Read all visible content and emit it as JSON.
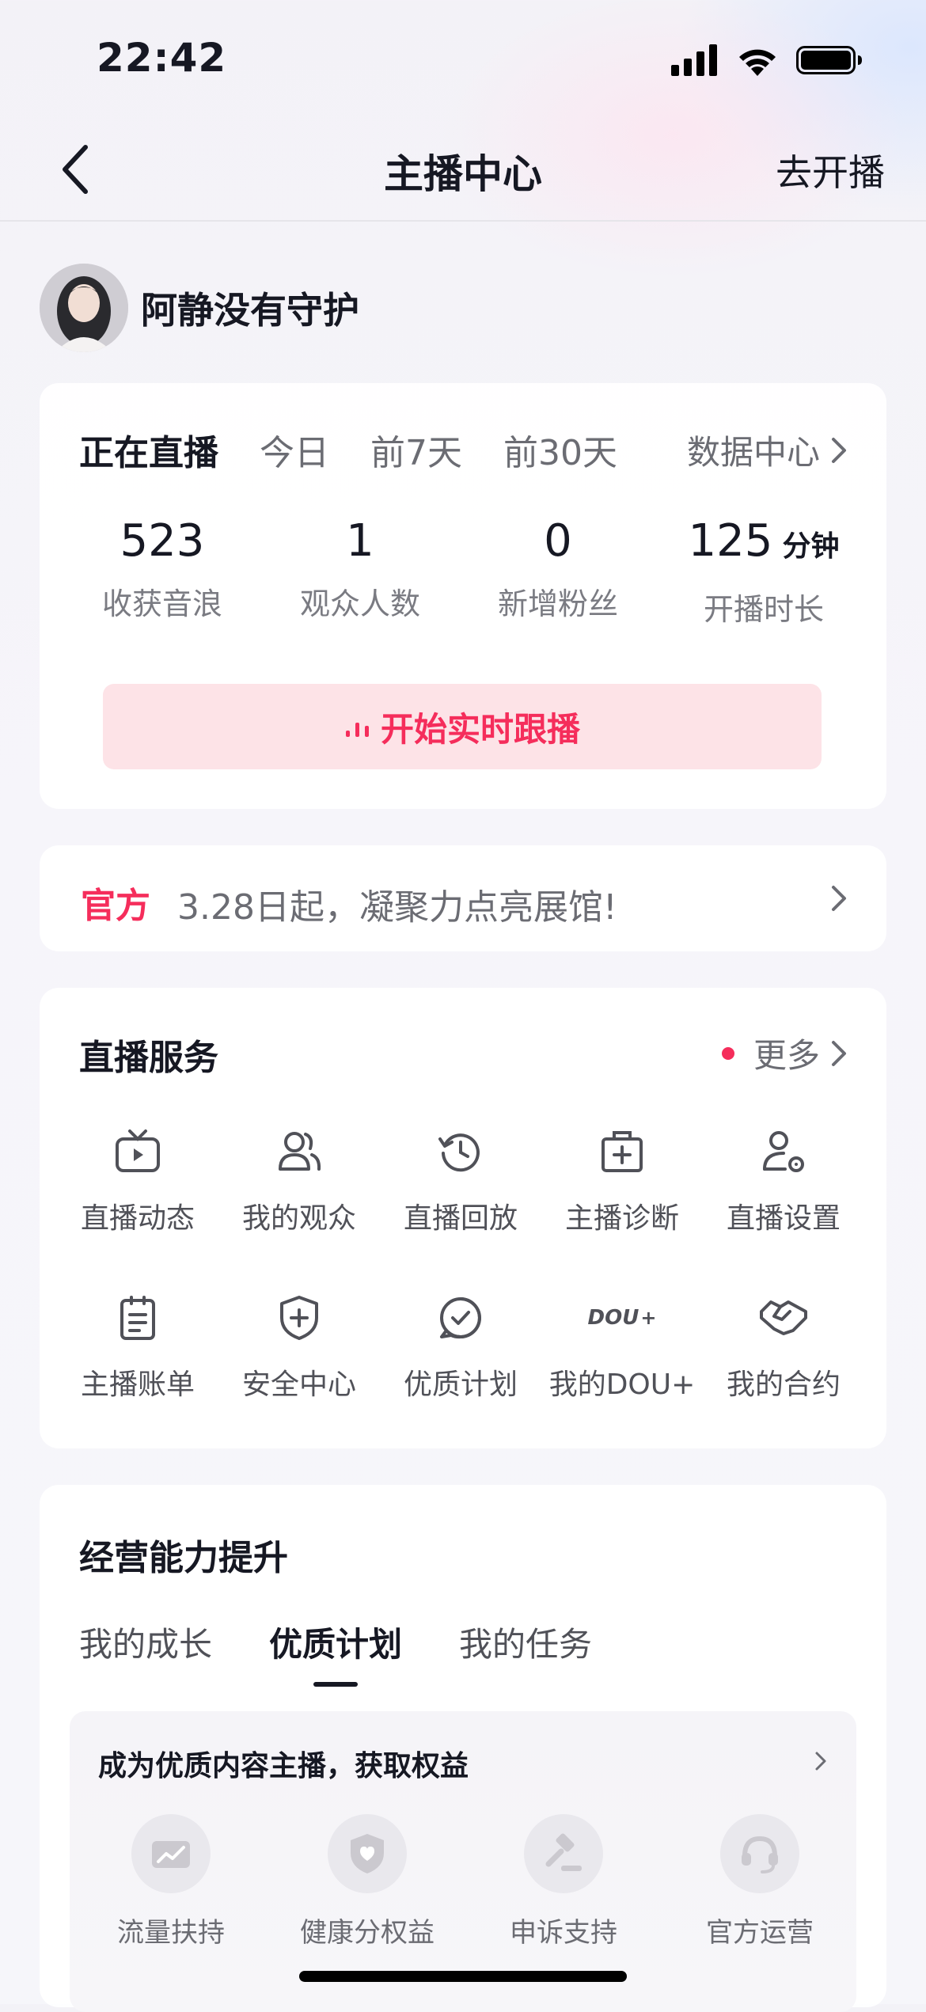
{
  "status_bar": {
    "time": "22:42"
  },
  "nav": {
    "title": "主播中心",
    "right_action": "去开播"
  },
  "user": {
    "name": "阿静没有守护"
  },
  "live_card": {
    "tabs": [
      "正在直播",
      "今日",
      "前7天",
      "前30天"
    ],
    "active_tab": "正在直播",
    "data_center": "数据中心",
    "stats": [
      {
        "value": "523",
        "unit": "",
        "label": "收获音浪"
      },
      {
        "value": "1",
        "unit": "",
        "label": "观众人数"
      },
      {
        "value": "0",
        "unit": "",
        "label": "新增粉丝"
      },
      {
        "value": "125",
        "unit": "分钟",
        "label": "开播时长"
      }
    ],
    "follow_button": "开始实时跟播"
  },
  "notice": {
    "tag": "官方",
    "text": "3.28日起，凝聚力点亮展馆!"
  },
  "services": {
    "title": "直播服务",
    "more": "更多",
    "items": [
      {
        "label": "直播动态",
        "icon": "tv-play-icon"
      },
      {
        "label": "我的观众",
        "icon": "audience-icon"
      },
      {
        "label": "直播回放",
        "icon": "replay-clock-icon"
      },
      {
        "label": "主播诊断",
        "icon": "diagnosis-kit-icon"
      },
      {
        "label": "直播设置",
        "icon": "user-settings-icon"
      },
      {
        "label": "主播账单",
        "icon": "bill-icon"
      },
      {
        "label": "安全中心",
        "icon": "shield-plus-icon"
      },
      {
        "label": "优质计划",
        "icon": "quality-check-icon"
      },
      {
        "label": "我的DOU+",
        "icon": "dou-plus-icon",
        "icon_text": "DOU"
      },
      {
        "label": "我的合约",
        "icon": "handshake-icon"
      }
    ]
  },
  "business": {
    "title": "经营能力提升",
    "tabs": [
      "我的成长",
      "优质计划",
      "我的任务"
    ],
    "active_tab": "优质计划",
    "banner_title": "成为优质内容主播，获取权益",
    "benefits": [
      {
        "label": "流量扶持",
        "icon": "traffic-icon"
      },
      {
        "label": "健康分权益",
        "icon": "health-shield-icon"
      },
      {
        "label": "申诉支持",
        "icon": "gavel-icon"
      },
      {
        "label": "官方运营",
        "icon": "headset-icon"
      }
    ]
  },
  "colors": {
    "accent": "#f52d5b",
    "accent_bg": "#fde3e7",
    "text": "#161823",
    "secondary": "#6b6c73"
  }
}
